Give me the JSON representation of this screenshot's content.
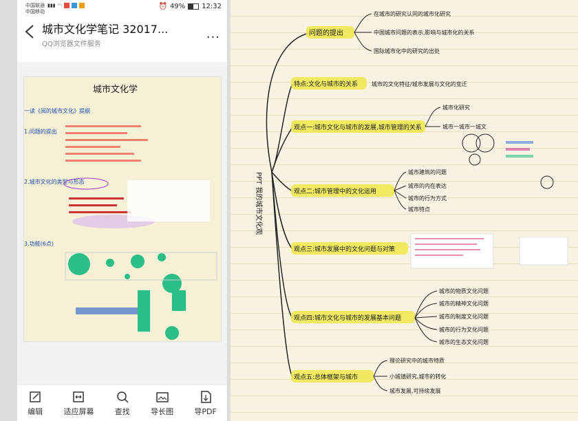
{
  "statusbar": {
    "carrier1": "中国联通",
    "carrier2": "中国移动",
    "battery": "49%",
    "time": "12:32",
    "icons": [
      "signal-icon",
      "wifi-icon",
      "alarm-icon",
      "battery-icon"
    ]
  },
  "header": {
    "title": "城市文化学笔记 32017...",
    "subtitle": "QQ浏览器文件服务",
    "back_icon": "back-chevron-icon",
    "more_label": "..."
  },
  "page_preview": {
    "heading": "城市文化学",
    "section1": "一读《阅的城市文化》提纲",
    "topics": [
      "1.问题的提出",
      "2.城市文化的类型与形态",
      "3.功能(6点)"
    ]
  },
  "footer": {
    "buttons": [
      {
        "label": "编辑",
        "icon": "edit-icon"
      },
      {
        "label": "适应屏幕",
        "icon": "fit-screen-icon"
      },
      {
        "label": "查找",
        "icon": "search-icon"
      },
      {
        "label": "导长图",
        "icon": "export-image-icon"
      },
      {
        "label": "导PDF",
        "icon": "export-pdf-icon"
      }
    ]
  },
  "notes": {
    "root": "PPT 我的城市文化观",
    "branches": [
      {
        "label": "问题的提出",
        "children": [
          "在城市的研究认同的城市化研究",
          "中国城市问题的表示,影响与城市化的关系",
          "国际城市化中的研究的出处"
        ]
      },
      {
        "label": "特点:文化与城市的关系",
        "children": [
          "城市的文化特征/城市发展与文化的变迁"
        ]
      },
      {
        "label": "观点一:城市文化与城市的发展,城市管理的关系",
        "children": [
          "城市化研究",
          "城市一城市一城文"
        ]
      },
      {
        "label": "观点二:城市管理中的文化运用",
        "children": [
          "城市建筑的问题",
          "城市的内在表达",
          "城市的行为方式",
          "城市特点"
        ]
      },
      {
        "label": "观点三:城市发展中的文化问题与对策",
        "children": []
      },
      {
        "label": "观点四:城市文化与城市的发展基本问题",
        "children": [
          "城市的物质文化问题",
          "城市的精神文化问题",
          "城市的制度文化问题",
          "城市的行为文化问题",
          "城市的生态文化问题"
        ]
      },
      {
        "label": "观点五:总体框架与城市",
        "children": [
          "理论研究中的城市特质",
          "小城镇研究,城市的转化",
          "城市发展,可持续发展"
        ]
      }
    ]
  },
  "colors": {
    "highlight": "#f0e84a",
    "ink": "#222222",
    "paper": "#f7f2e1"
  }
}
